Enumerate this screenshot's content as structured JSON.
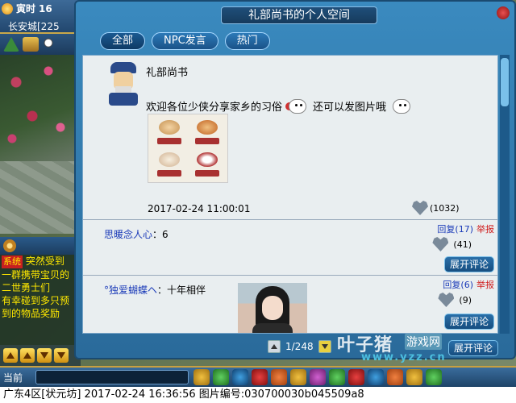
{
  "hud": {
    "time_label": "寅时",
    "time_num": "16",
    "map_name": "长安城[225"
  },
  "dialog": {
    "title": "礼部尚书的个人空间",
    "tabs": [
      "全部",
      "NPC发言",
      "热门"
    ]
  },
  "post": {
    "author": "礼部尚书",
    "text_before": "欢迎各位少侠分享家乡的习俗",
    "text_after": "还可以发图片哦",
    "datetime": "2017-02-24 11:00:01",
    "likes": "(1032)"
  },
  "replies": [
    {
      "user": "思暖念人心",
      "message": "6",
      "reply_label": "回复",
      "reply_count": "(17)",
      "report_label": "举报",
      "likes": "(41)",
      "expand_label": "展开评论"
    },
    {
      "user": "°独爱蝴蝶ヘ",
      "message": "十年相伴",
      "reply_label": "回复",
      "reply_count": "(6)",
      "report_label": "举报",
      "likes": "(9)",
      "expand_label": "展开评论"
    }
  ],
  "third_expand_label": "展开评论",
  "pager": {
    "text": "1/248"
  },
  "chat": {
    "tag": "系统",
    "lines": [
      "突然受到",
      "一群携带宝贝的",
      "二世勇士们",
      "有幸碰到多只预",
      "到的物品奖励"
    ]
  },
  "toolbar": {
    "current_label": "当前"
  },
  "statusbar": {
    "text": "广东4区[状元坊] 2017-02-24 16:36:56 图片编号:030700030b045509a8"
  },
  "watermark": {
    "big": "叶子猪",
    "tag": "游戏网",
    "url": "www.yzz.cn"
  }
}
